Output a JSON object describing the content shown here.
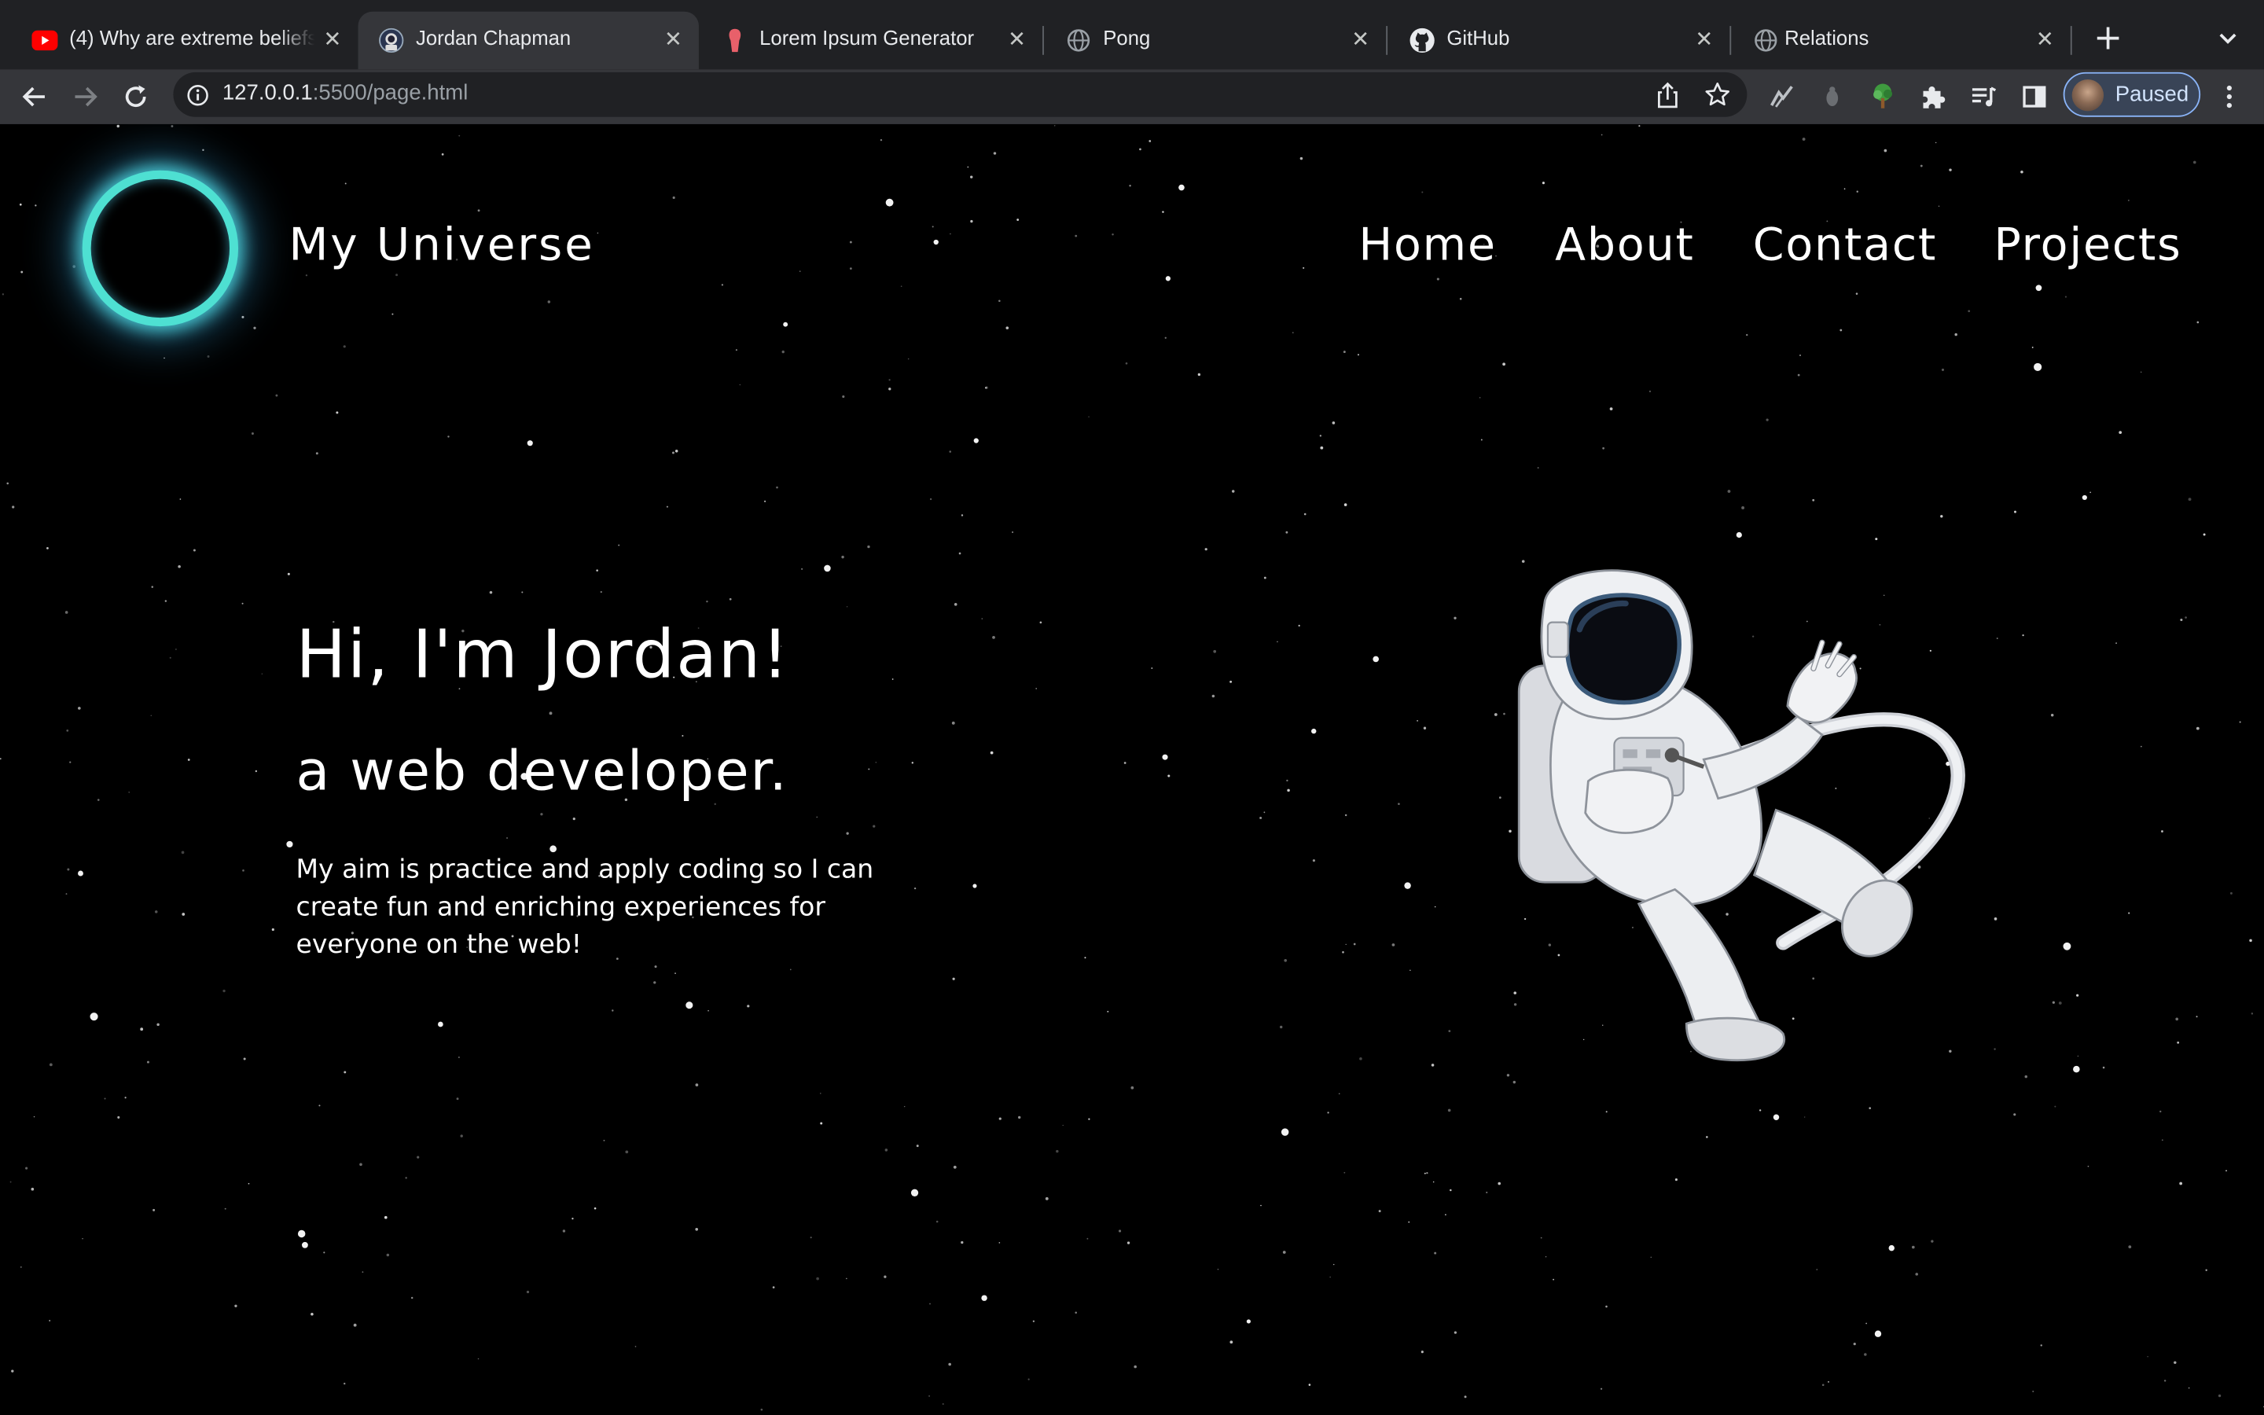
{
  "browser": {
    "tabs": [
      {
        "title": "(4) Why are extreme beliefs",
        "icon": "youtube-icon",
        "active": false
      },
      {
        "title": "Jordan Chapman",
        "icon": "astronaut-favicon-icon",
        "active": true
      },
      {
        "title": "Lorem Ipsum Generator",
        "icon": "lorem-ipsum-favicon-icon",
        "active": false
      },
      {
        "title": "Pong",
        "icon": "globe-icon",
        "active": false
      },
      {
        "title": "GitHub",
        "icon": "github-icon",
        "active": false
      },
      {
        "title": "Relations",
        "icon": "globe-icon",
        "active": false
      }
    ],
    "tab_close_glyph": "✕",
    "new_tab_glyph": "+",
    "address": {
      "host": "127.0.0.1",
      "path": ":5500/page.html"
    },
    "profile": {
      "label": "Paused"
    },
    "colors": {
      "tabstrip": "#202124",
      "toolbar": "#35363a",
      "profile_border": "#8ab4f8"
    }
  },
  "site": {
    "title": "My Universe",
    "nav": [
      "Home",
      "About",
      "Contact",
      "Projects"
    ],
    "hero": {
      "greeting": "Hi, I'm Jordan!",
      "role": "a web developer.",
      "description_lines": [
        "My aim is practice and apply coding so I can",
        "create fun and enriching experiences for",
        "everyone on the web!"
      ]
    },
    "colors": {
      "background": "#000000",
      "text": "#ffffff",
      "logo_ring": "#4ee0d2",
      "logo_glow": "#3aa8e6"
    },
    "icons": {
      "logo": "glowing-ring-logo",
      "illustration": "floating-astronaut"
    }
  }
}
